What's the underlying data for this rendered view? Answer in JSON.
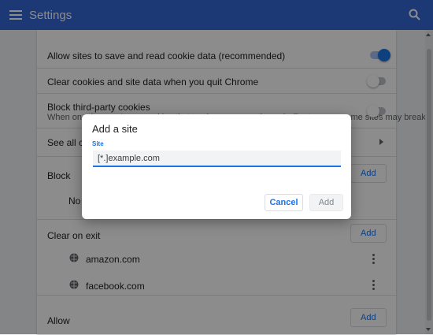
{
  "header": {
    "title": "Settings",
    "menu_icon": "menu-icon",
    "search_icon": "search-icon"
  },
  "settings": {
    "allow_cookies_label": "Allow sites to save and read cookie data (recommended)",
    "allow_cookies_on": true,
    "clear_on_quit_label": "Clear cookies and site data when you quit Chrome",
    "clear_on_quit_on": false,
    "block_third_party_label": "Block third-party cookies",
    "block_third_party_desc": "When on, sites can't use cookies that track you across the web. Features on some sites may break",
    "block_third_party_on": false,
    "see_all_label": "See all cookies and site data",
    "block_section": {
      "title": "Block",
      "add_label": "Add",
      "empty_text": "No sites added"
    },
    "clear_section": {
      "title": "Clear on exit",
      "add_label": "Add",
      "sites": [
        {
          "name": "amazon.com"
        },
        {
          "name": "facebook.com"
        }
      ]
    },
    "allow_section": {
      "title": "Allow",
      "add_label": "Add"
    }
  },
  "dialog": {
    "title": "Add a site",
    "field_label": "Site",
    "input_value": "[*.]example.com",
    "cancel_label": "Cancel",
    "add_label": "Add"
  },
  "colors": {
    "accent": "#1a73e8",
    "header": "#3367d6"
  }
}
